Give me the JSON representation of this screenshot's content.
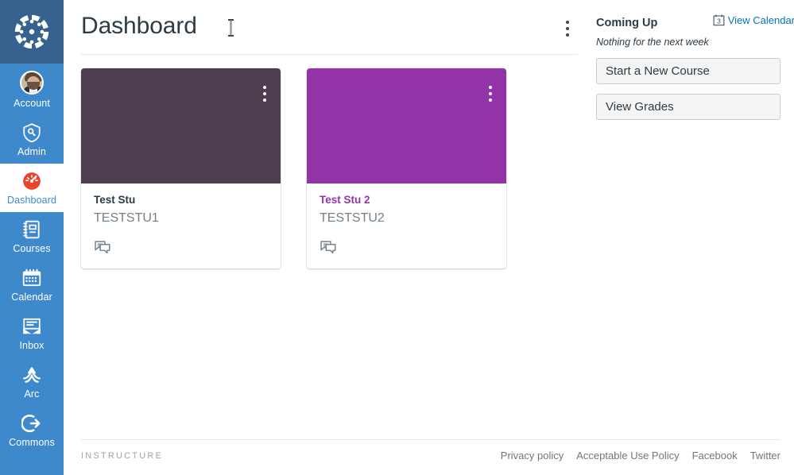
{
  "globalnav": {
    "logo": "canvas-logo",
    "items": [
      {
        "label": "Account",
        "icon": "user-avatar",
        "active": false
      },
      {
        "label": "Admin",
        "icon": "shield-icon",
        "active": false
      },
      {
        "label": "Dashboard",
        "icon": "dashboard-gauge-icon",
        "active": true
      },
      {
        "label": "Courses",
        "icon": "courses-book-icon",
        "active": false
      },
      {
        "label": "Calendar",
        "icon": "calendar-icon",
        "active": false
      },
      {
        "label": "Inbox",
        "icon": "inbox-envelope-icon",
        "active": false
      },
      {
        "label": "Arc",
        "icon": "arc-icon",
        "active": false
      },
      {
        "label": "Commons",
        "icon": "commons-arrow-icon",
        "active": false
      }
    ]
  },
  "header": {
    "title": "Dashboard",
    "options_menu": "dashboard-options-kebab"
  },
  "cards": [
    {
      "title": "Test Stu",
      "code": "TESTSTU1",
      "header_color": "#4d3d4e",
      "title_color": "#2d3b45",
      "menu": "course-card-options",
      "links": [
        {
          "icon": "discussions-icon",
          "label": "Discussions"
        }
      ]
    },
    {
      "title": "Test Stu 2",
      "code": "TESTSTU2",
      "header_color": "#9333a8",
      "title_color": "#9333a8",
      "menu": "course-card-options",
      "links": [
        {
          "icon": "discussions-icon",
          "label": "Discussions"
        }
      ]
    }
  ],
  "right_sidebar": {
    "coming_up_title": "Coming Up",
    "view_calendar_label": "View Calendar",
    "calendar_icon_day": "3",
    "empty_message": "Nothing for the next week",
    "buttons": [
      {
        "label": "Start a New Course"
      },
      {
        "label": "View Grades"
      }
    ]
  },
  "footer": {
    "brand": "INSTRUCTURE",
    "links": [
      {
        "label": "Privacy policy"
      },
      {
        "label": "Acceptable Use Policy"
      },
      {
        "label": "Facebook"
      },
      {
        "label": "Twitter"
      }
    ]
  },
  "colors": {
    "nav_blue": "#3e88cc",
    "nav_logo_blue": "#37618e",
    "link_blue": "#0374b5",
    "text_dark": "#2d3b45",
    "text_muted": "#73818c"
  }
}
